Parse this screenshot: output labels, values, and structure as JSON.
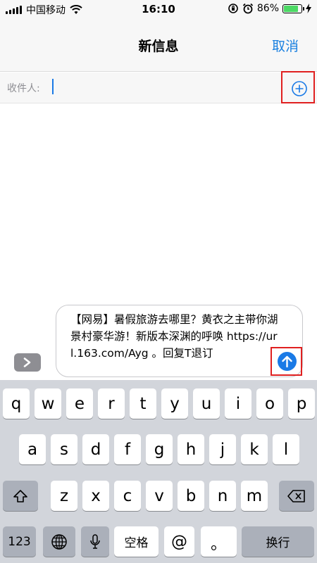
{
  "status_bar": {
    "carrier": "中国移动",
    "time": "16:10",
    "battery_percent": "86%",
    "battery_level": 0.86,
    "icons": [
      "signal-icon",
      "wifi-icon",
      "orientation-lock-icon",
      "alarm-icon",
      "battery-icon",
      "charging-icon"
    ]
  },
  "nav": {
    "title": "新信息",
    "cancel_label": "取消"
  },
  "recipient": {
    "label": "收件人:",
    "value": ""
  },
  "compose": {
    "message": "【网易】暑假旅游去哪里？黄衣之主带你湖景村豪华游！新版本深渊的呼唤 https://url.163.com/Ayg 。回复T退订"
  },
  "keyboard": {
    "row1": [
      "q",
      "w",
      "e",
      "r",
      "t",
      "y",
      "u",
      "i",
      "o",
      "p"
    ],
    "row2": [
      "a",
      "s",
      "d",
      "f",
      "g",
      "h",
      "j",
      "k",
      "l"
    ],
    "row3": [
      "z",
      "x",
      "c",
      "v",
      "b",
      "n",
      "m"
    ],
    "numbers_label": "123",
    "space_label": "空格",
    "at_label": "@",
    "dot_label": "。",
    "return_label": "换行"
  },
  "colors": {
    "accent": "#1a7ae6",
    "highlight_box": "#e02020",
    "keyboard_bg": "#d2d5db"
  }
}
